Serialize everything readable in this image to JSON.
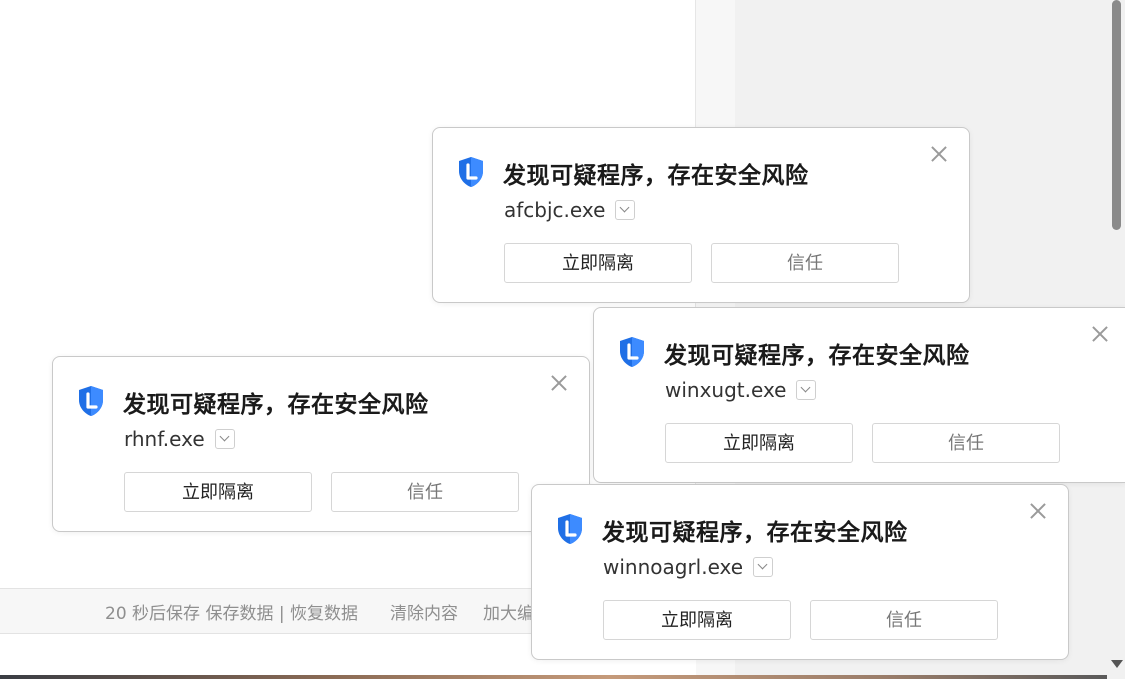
{
  "footer": {
    "autosave_text": "20 秒后保存 保存数据 | 恢复数据",
    "clear_text": "清除内容",
    "enlarge_text": "加大编"
  },
  "popups": [
    {
      "title": "发现可疑程序，存在安全风险",
      "filename": "afcbjc.exe",
      "isolate_label": "立即隔离",
      "trust_label": "信任"
    },
    {
      "title": "发现可疑程序，存在安全风险",
      "filename": "rhnf.exe",
      "isolate_label": "立即隔离",
      "trust_label": "信任"
    },
    {
      "title": "发现可疑程序，存在安全风险",
      "filename": "winxugt.exe",
      "isolate_label": "立即隔离",
      "trust_label": "信任"
    },
    {
      "title": "发现可疑程序，存在安全风险",
      "filename": "winnoagrl.exe",
      "isolate_label": "立即隔离",
      "trust_label": "信任"
    }
  ],
  "colors": {
    "shield_blue": "#1f6fe6",
    "shield_light": "#5aa3ff"
  },
  "icons": {
    "shield": "shield-icon",
    "close": "close-icon",
    "chevron": "chevron-down-icon"
  }
}
